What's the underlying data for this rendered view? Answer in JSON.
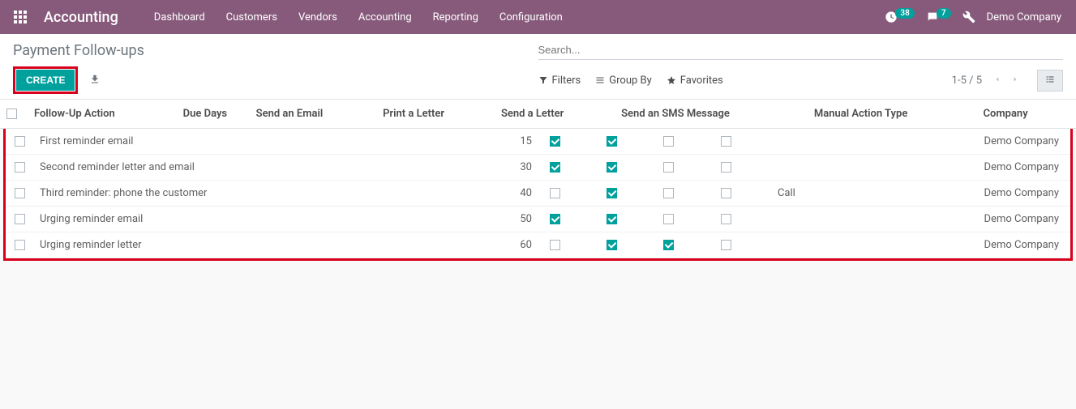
{
  "colors": {
    "brand": "#875a7b",
    "accent": "#00a09d",
    "highlight": "#d9001b"
  },
  "topnav": {
    "app_name": "Accounting",
    "menu": [
      "Dashboard",
      "Customers",
      "Vendors",
      "Accounting",
      "Reporting",
      "Configuration"
    ],
    "activities_count": "38",
    "messages_count": "7",
    "company": "Demo Company"
  },
  "breadcrumb": "Payment Follow-ups",
  "actions": {
    "create": "Create"
  },
  "search": {
    "placeholder": "Search...",
    "filters": "Filters",
    "groupby": "Group By",
    "favorites": "Favorites"
  },
  "pager": {
    "range": "1-5 / 5"
  },
  "table": {
    "headers": {
      "action": "Follow-Up Action",
      "due": "Due Days",
      "email": "Send an Email",
      "print": "Print a Letter",
      "send_letter": "Send a Letter",
      "sms": "Send an SMS Message",
      "manual": "Manual Action Type",
      "company": "Company"
    },
    "rows": [
      {
        "action": "First reminder email",
        "due": "15",
        "email": true,
        "print": true,
        "send_letter": false,
        "sms": false,
        "manual": "",
        "company": "Demo Company"
      },
      {
        "action": "Second reminder letter and email",
        "due": "30",
        "email": true,
        "print": true,
        "send_letter": false,
        "sms": false,
        "manual": "",
        "company": "Demo Company"
      },
      {
        "action": "Third reminder: phone the customer",
        "due": "40",
        "email": false,
        "print": true,
        "send_letter": false,
        "sms": false,
        "manual": "Call",
        "company": "Demo Company"
      },
      {
        "action": "Urging reminder email",
        "due": "50",
        "email": true,
        "print": true,
        "send_letter": false,
        "sms": false,
        "manual": "",
        "company": "Demo Company"
      },
      {
        "action": "Urging reminder letter",
        "due": "60",
        "email": false,
        "print": true,
        "send_letter": true,
        "sms": false,
        "manual": "",
        "company": "Demo Company"
      }
    ]
  }
}
